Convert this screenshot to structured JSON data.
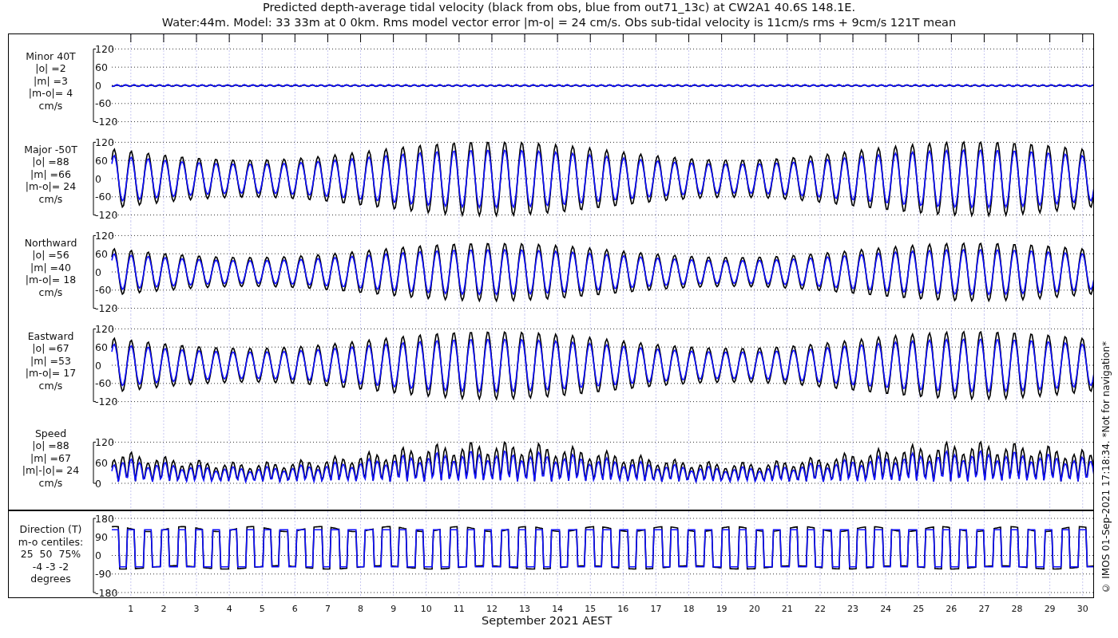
{
  "title_lines": [
    "Predicted depth-average tidal velocity (black from obs, blue from out71_13c) at CW2A1 40.6S 148.1E.",
    "Water:44m. Model: 33 33m at 0 0km. Rms model vector error |m-o| = 24 cm/s. Obs sub-tidal velocity is 11cm/s rms + 9cm/s 121T mean"
  ],
  "panels": [
    {
      "kind": "minor",
      "label_lines": [
        "Minor 40T",
        "|o| =2",
        "|m| =3",
        "|m-o|= 4",
        "cm/s"
      ],
      "yticks": [
        "120",
        "60",
        "0",
        "-60",
        "-120"
      ]
    },
    {
      "kind": "major",
      "label_lines": [
        "Major -50T",
        "|o| =88",
        "|m| =66",
        "|m-o|= 24",
        "cm/s"
      ],
      "yticks": [
        "120",
        "60",
        "0",
        "-60",
        "-120"
      ]
    },
    {
      "kind": "north",
      "label_lines": [
        "Northward",
        "|o| =56",
        "|m| =40",
        "|m-o|= 18",
        "cm/s"
      ],
      "yticks": [
        "120",
        "60",
        "0",
        "-60",
        "-120"
      ]
    },
    {
      "kind": "east",
      "label_lines": [
        "Eastward",
        "|o| =67",
        "|m| =53",
        "|m-o|= 17",
        "cm/s"
      ],
      "yticks": [
        "120",
        "60",
        "0",
        "-60",
        "-120"
      ]
    },
    {
      "kind": "speed",
      "label_lines": [
        "Speed",
        "|o| =88",
        "|m| =67",
        "|m|-|o|= 24",
        "cm/s"
      ],
      "yticks": [
        "120",
        "60",
        "0"
      ]
    },
    {
      "kind": "direction",
      "label_lines": [
        "Direction (T)",
        "m-o centiles:",
        "25  50  75%",
        "-4 -3 -2",
        "degrees"
      ],
      "yticks": [
        "180",
        "90",
        "0",
        "-90",
        "-180"
      ]
    }
  ],
  "x_axis": {
    "day_labels": [
      "1",
      "2",
      "3",
      "4",
      "5",
      "6",
      "7",
      "8",
      "9",
      "10",
      "11",
      "12",
      "13",
      "14",
      "15",
      "16",
      "17",
      "18",
      "19",
      "20",
      "21",
      "22",
      "23",
      "24",
      "25",
      "26",
      "27",
      "28",
      "29",
      "30"
    ],
    "title": "September 2021 AEST"
  },
  "side_note": "© IMOS 01-Sep-2021 17:18:34. *Not for navigation*"
}
